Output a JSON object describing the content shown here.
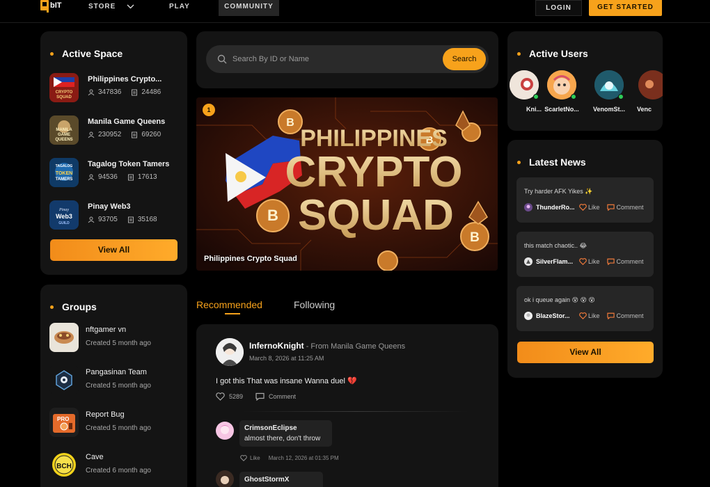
{
  "nav": {
    "store": "STORE",
    "play": "PLAY",
    "community": "COMMUNITY",
    "login": "LOGIN",
    "get_started": "GET STARTED"
  },
  "active_space": {
    "title": "Active Space",
    "items": [
      {
        "name": "Philippines Crypto...",
        "members": "347836",
        "posts": "24486"
      },
      {
        "name": "Manila Game Queens",
        "members": "230952",
        "posts": "69260"
      },
      {
        "name": "Tagalog Token Tamers",
        "members": "94536",
        "posts": "17613"
      },
      {
        "name": "Pinay Web3",
        "members": "93705",
        "posts": "35168"
      }
    ],
    "view_all": "View All"
  },
  "groups": {
    "title": "Groups",
    "items": [
      {
        "name": "nftgamer vn",
        "created": "Created 5 month ago"
      },
      {
        "name": "Pangasinan Team",
        "created": "Created 5 month ago"
      },
      {
        "name": "Report Bug",
        "created": "Created 5 month ago"
      },
      {
        "name": "Cave",
        "created": "Created 6 month ago"
      }
    ]
  },
  "search": {
    "placeholder": "Search By ID or Name",
    "button": "Search"
  },
  "banner": {
    "badge": "1",
    "line1": "PHILIPPINES",
    "line2": "CRYPTO",
    "line3": "SQUAD",
    "caption": "Philippines Crypto Squad"
  },
  "tabs": {
    "recommended": "Recommended",
    "following": "Following"
  },
  "post": {
    "author": "InfernoKnight",
    "from": " - From Manila Game Queens",
    "date": "March 8, 2026 at 11:25 AM",
    "text": "I got this That was insane Wanna duel 💔",
    "likes": "5289",
    "comment_label": "Comment",
    "comments": [
      {
        "name": "CrimsonEclipse",
        "text": "almost there, don't throw",
        "like": "Like",
        "date": "March 12, 2026 at 01:35 PM"
      },
      {
        "name": "GhostStormX",
        "text": ""
      }
    ]
  },
  "active_users": {
    "title": "Active Users",
    "users": [
      {
        "name": "Kni..."
      },
      {
        "name": "ScarletNo..."
      },
      {
        "name": "VenomSt..."
      },
      {
        "name": "Venc"
      }
    ]
  },
  "latest_news": {
    "title": "Latest News",
    "items": [
      {
        "text": "Try harder AFK Yikes ✨",
        "user": "ThunderRo...",
        "like": "Like",
        "comment": "Comment"
      },
      {
        "text": "this match chaotic.. 😂",
        "user": "SilverFlam...",
        "like": "Like",
        "comment": "Comment"
      },
      {
        "text": "ok i queue again 😵 😵 😵",
        "user": "BlazeStor...",
        "like": "Like",
        "comment": "Comment"
      }
    ],
    "view_all": "View All"
  },
  "colors": {
    "accent": "#f7a21b",
    "panel": "#141414",
    "background": "#000000",
    "online": "#2ecc57"
  }
}
